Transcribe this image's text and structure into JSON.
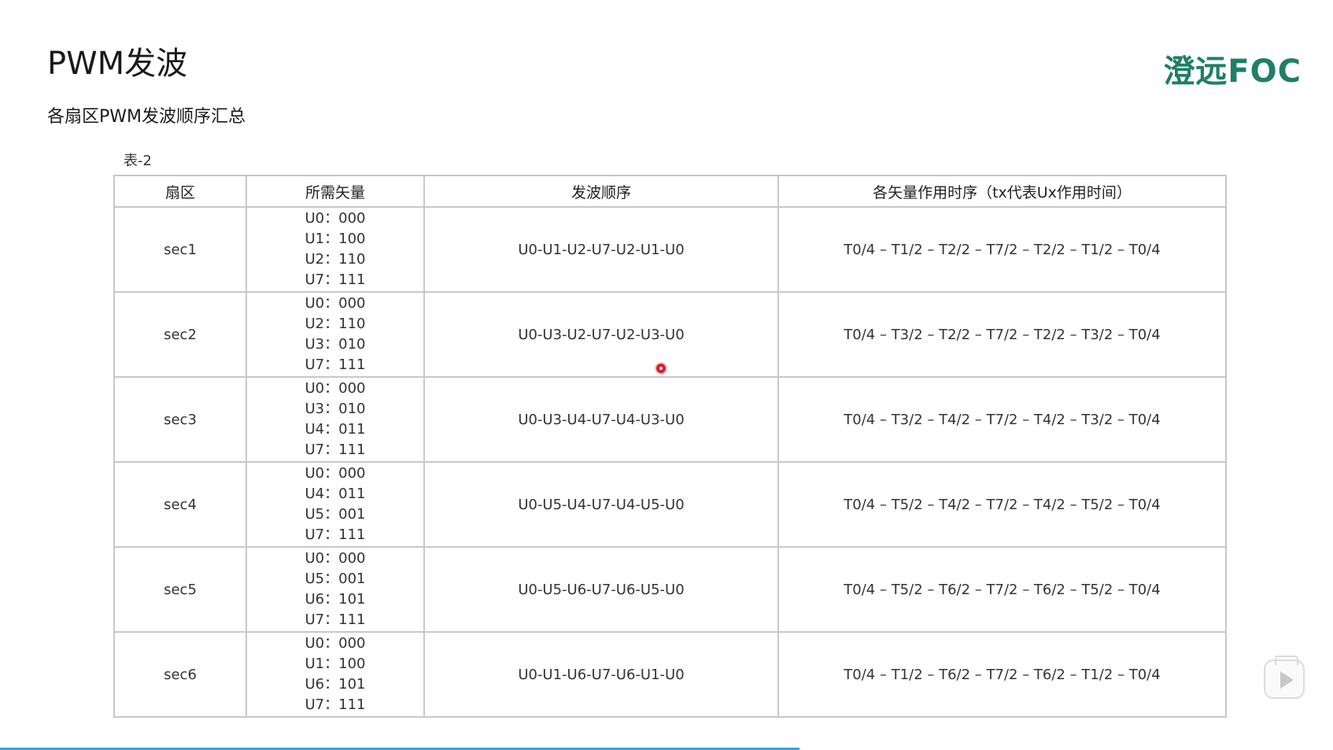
{
  "slide": {
    "title": "PWM发波",
    "subtitle": "各扇区PWM发波顺序汇总",
    "logo_text": "澄远FOC",
    "table_caption": "表-2"
  },
  "table": {
    "headers": [
      "扇区",
      "所需矢量",
      "发波顺序",
      "各矢量作用时序（tx代表Ux作用时间）"
    ],
    "rows": [
      {
        "sector": "sec1",
        "vectors": [
          "U0：000",
          "U1：100",
          "U2：110",
          "U7：111"
        ],
        "order": "U0-U1-U2-U7-U2-U1-U0",
        "timing": "T0/4 – T1/2 – T2/2 – T7/2 – T2/2 – T1/2 – T0/4"
      },
      {
        "sector": "sec2",
        "vectors": [
          "U0：000",
          "U2：110",
          "U3：010",
          "U7：111"
        ],
        "order": "U0-U3-U2-U7-U2-U3-U0",
        "timing": "T0/4 – T3/2 – T2/2 – T7/2 – T2/2 – T3/2 – T0/4"
      },
      {
        "sector": "sec3",
        "vectors": [
          "U0：000",
          "U3：010",
          "U4：011",
          "U7：111"
        ],
        "order": "U0-U3-U4-U7-U4-U3-U0",
        "timing": "T0/4 – T3/2 – T4/2 – T7/2 – T4/2 – T3/2 – T0/4"
      },
      {
        "sector": "sec4",
        "vectors": [
          "U0：000",
          "U4：011",
          "U5：001",
          "U7：111"
        ],
        "order": "U0-U5-U4-U7-U4-U5-U0",
        "timing": "T0/4 – T5/2 – T4/2 – T7/2 – T4/2 – T5/2 – T0/4"
      },
      {
        "sector": "sec5",
        "vectors": [
          "U0：000",
          "U5：001",
          "U6：101",
          "U7：111"
        ],
        "order": "U0-U5-U6-U7-U6-U5-U0",
        "timing": "T0/4 – T5/2 – T6/2 – T7/2 – T6/2 – T5/2 – T0/4"
      },
      {
        "sector": "sec6",
        "vectors": [
          "U0：000",
          "U1：100",
          "U6：101",
          "U7：111"
        ],
        "order": "U0-U1-U6-U7-U6-U1-U0",
        "timing": "T0/4 – T1/2 – T6/2 – T7/2 – T6/2 – T1/2 – T0/4"
      }
    ]
  },
  "player": {
    "progress_fraction": 0.6,
    "play_icon": "play-icon"
  },
  "colors": {
    "logo": "#1f7f67",
    "progress": "#27a9e1",
    "cursor": "#d81e2c",
    "table_border": "#c8c8c8"
  }
}
